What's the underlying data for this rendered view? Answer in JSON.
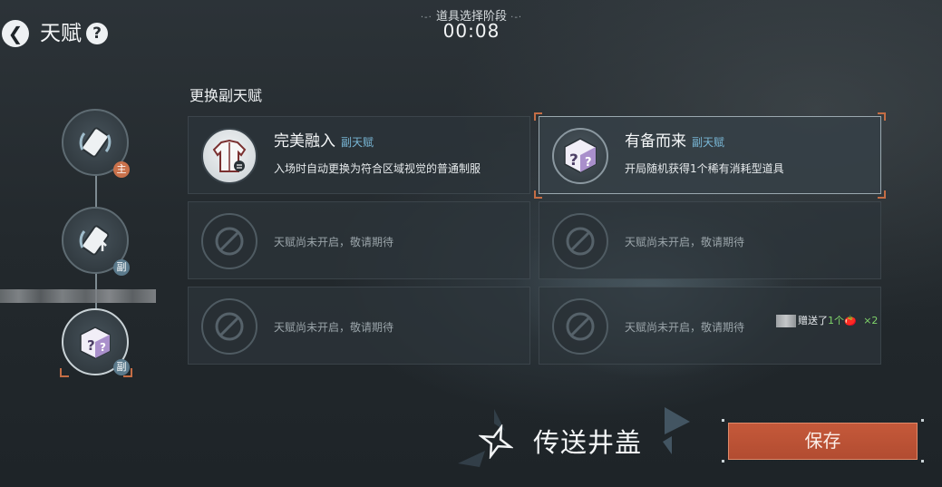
{
  "header": {
    "title": "天赋",
    "help_icon_label": "?",
    "phase_label": "道具选择阶段",
    "phase_dots": "·-·",
    "timer": "00:08"
  },
  "chain": {
    "nodes": [
      {
        "badge": "主",
        "badge_color": "#c9714b",
        "selected": false
      },
      {
        "badge": "副",
        "badge_color": "#5b7a8c",
        "selected": false
      },
      {
        "badge": "副",
        "badge_color": "#5b7a8c",
        "selected": true
      }
    ]
  },
  "section": {
    "title": "更换副天赋"
  },
  "cards": [
    {
      "name": "完美融入",
      "tag": "副天赋",
      "desc": "入场时自动更换为符合区域视觉的普通制服",
      "icon": "uniform-icon",
      "state": "available"
    },
    {
      "name": "有备而来",
      "tag": "副天赋",
      "desc": "开局随机获得1个稀有消耗型道具",
      "icon": "mystery-box-icon",
      "state": "selected"
    },
    {
      "locked_text": "天赋尚未开启，敬请期待",
      "icon": "locked-icon",
      "state": "locked"
    },
    {
      "locked_text": "天赋尚未开启，敬请期待",
      "icon": "locked-icon",
      "state": "locked"
    },
    {
      "locked_text": "天赋尚未开启，敬请期待",
      "icon": "locked-icon",
      "state": "locked"
    },
    {
      "locked_text": "天赋尚未开启，敬请期待",
      "icon": "locked-icon",
      "state": "locked"
    }
  ],
  "kill_feed": {
    "verb": "赠送了",
    "count": "1个",
    "item": "🍅",
    "multiplier": "×2"
  },
  "bottom": {
    "skill_name": "传送井盖",
    "save_label": "保存"
  },
  "colors": {
    "accent": "#c46d45",
    "save_button": "#b24c31",
    "tag": "#79b7d6"
  }
}
